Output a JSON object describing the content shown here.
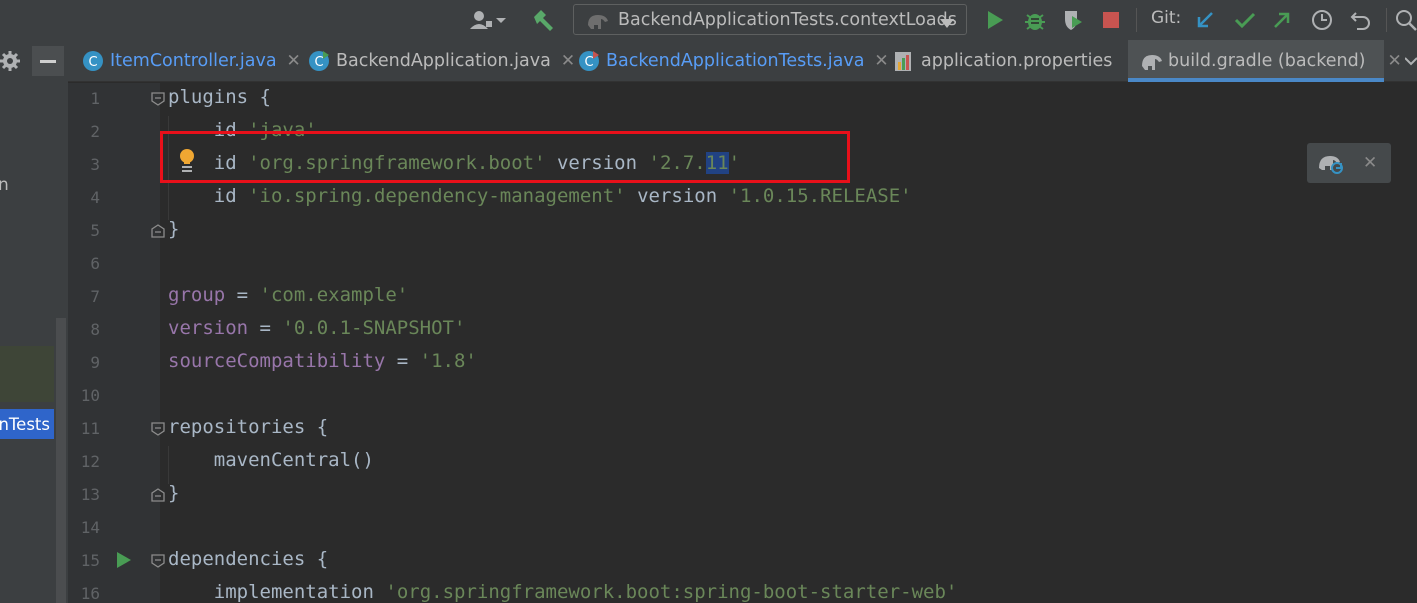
{
  "toolbar": {
    "run_config_label": "BackendApplicationTests.contextLoads",
    "git_label": "Git:"
  },
  "left_panel": {
    "truncated_char": "n",
    "selected_item_label": "nTests"
  },
  "tabs": [
    {
      "label": "ItemController.java",
      "color": "#589df6"
    },
    {
      "label": "BackendApplication.java",
      "color": "#bbbbbb"
    },
    {
      "label": "BackendApplicationTests.java",
      "color": "#589df6"
    },
    {
      "label": "application.properties",
      "color": "#bbbbbb"
    },
    {
      "label": "build.gradle (backend)",
      "color": "#bbbbbb",
      "active": true
    }
  ],
  "editor": {
    "line_numbers": [
      "1",
      "2",
      "3",
      "4",
      "5",
      "6",
      "7",
      "8",
      "9",
      "10",
      "11",
      "12",
      "13",
      "14",
      "15",
      "16"
    ],
    "lines": {
      "l1": {
        "text": "plugins {"
      },
      "l2": {
        "kw": "id",
        "str": "'java'"
      },
      "l3": {
        "kw": "id",
        "str": "'org.springframework.boot'",
        "mid": "version",
        "str2a": "'2.7.",
        "str2sel": "11",
        "str2b": "'"
      },
      "l4": {
        "kw": "id",
        "str": "'io.spring.dependency-management'",
        "mid": "version",
        "str2": "'1.0.15.RELEASE'"
      },
      "l5": {
        "text": "}"
      },
      "l7": {
        "prop": "group",
        "eq": " = ",
        "str": "'com.example'"
      },
      "l8": {
        "prop": "version",
        "eq": " = ",
        "str": "'0.0.1-SNAPSHOT'"
      },
      "l9": {
        "prop": "sourceCompatibility",
        "eq": " = ",
        "str": "'1.8'"
      },
      "l11": {
        "text": "repositories {"
      },
      "l12": {
        "text": "mavenCentral()"
      },
      "l13": {
        "text": "}"
      },
      "l15": {
        "text": "dependencies {"
      },
      "l16": {
        "kw": "implementation",
        "str": "'org.springframework.boot:spring-boot-starter-web'"
      }
    }
  },
  "colors": {
    "highlight_box": "#e8101a",
    "active_tab_underline": "#4a88c7"
  }
}
